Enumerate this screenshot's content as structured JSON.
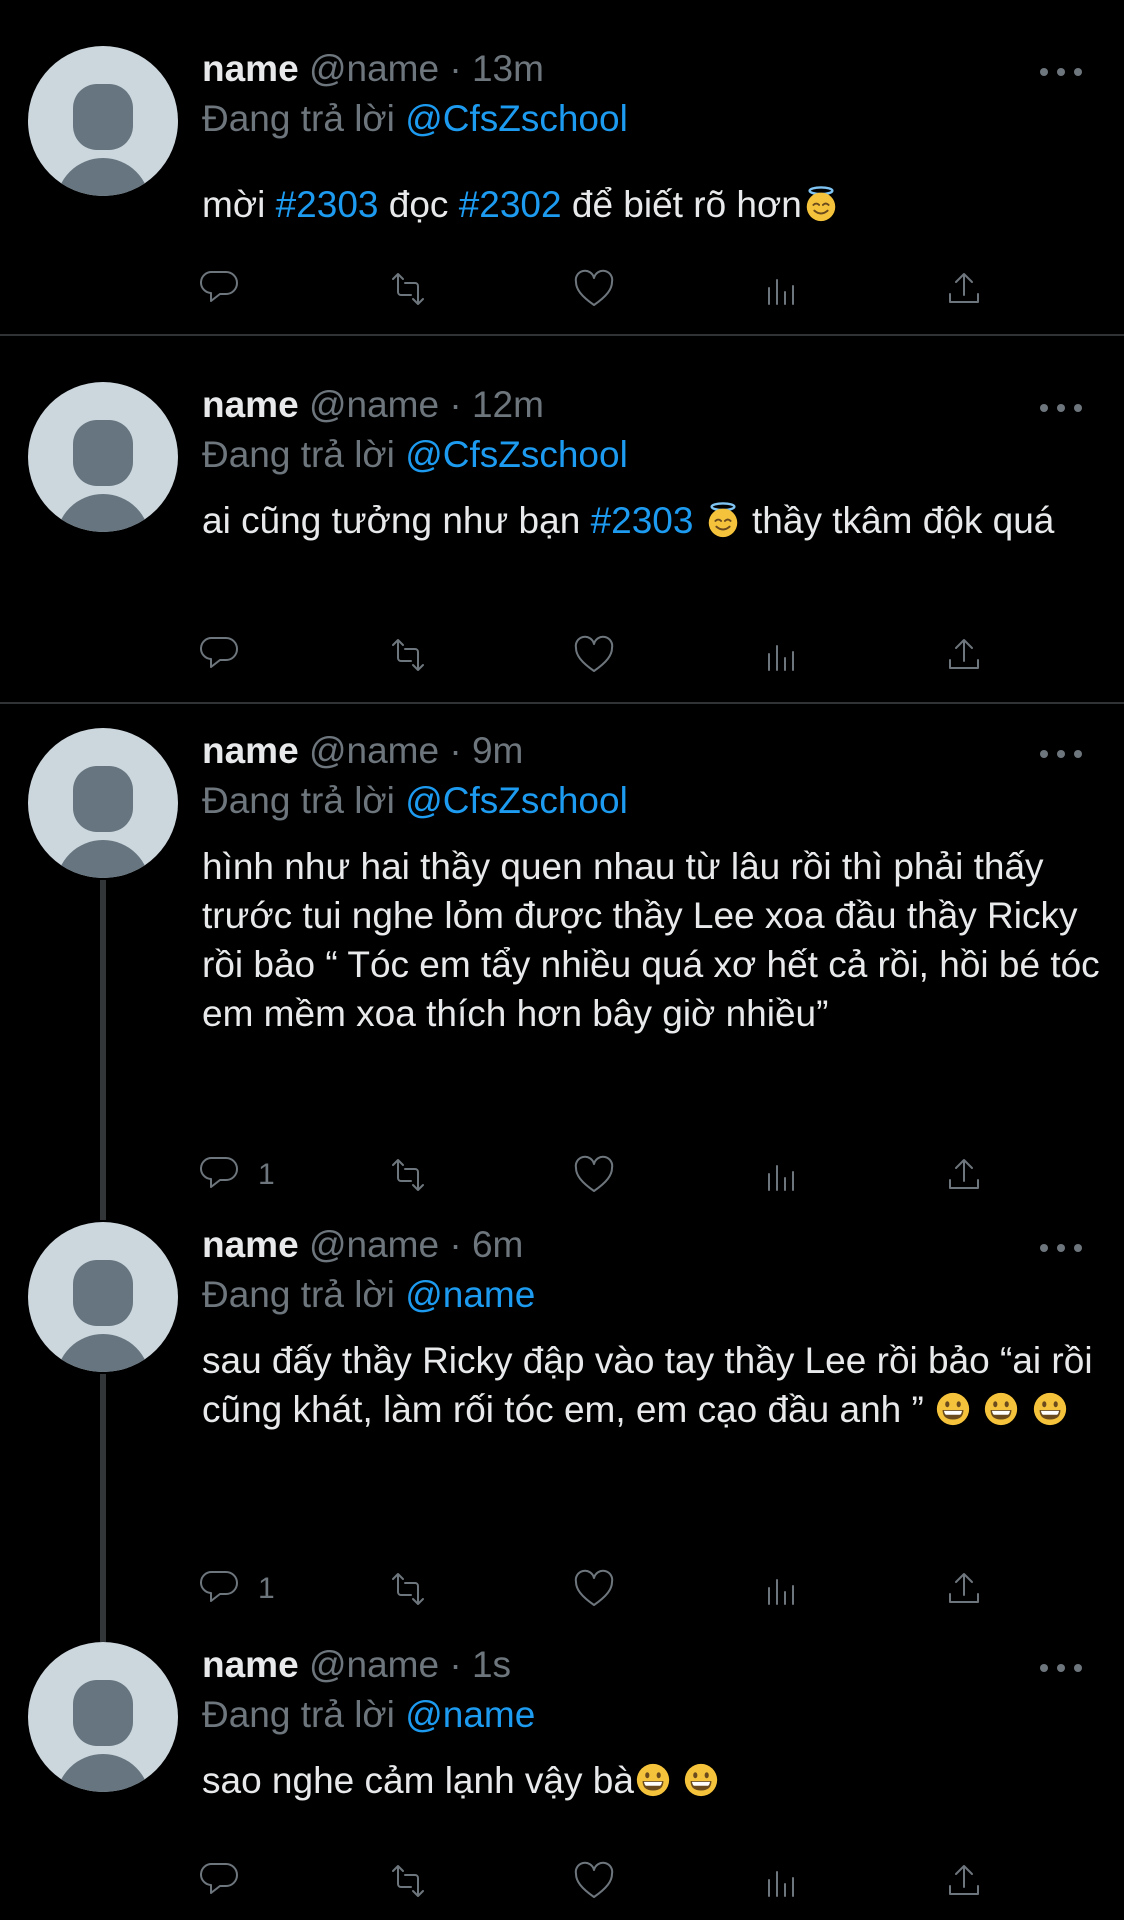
{
  "tweets": [
    {
      "name": "name",
      "handle": "@name",
      "dot": "·",
      "time": "13m",
      "reply_prefix": "Đang trả lời",
      "reply_to": "@CfsZschool",
      "reply_count": "",
      "segments": [
        {
          "t": "mời "
        },
        {
          "t": "#2303",
          "link": true
        },
        {
          "t": " đọc "
        },
        {
          "t": "#2302",
          "link": true
        },
        {
          "t": " để biết rõ hơn"
        },
        {
          "emoji": "halo"
        }
      ]
    },
    {
      "name": "name",
      "handle": "@name",
      "dot": "·",
      "time": "12m",
      "reply_prefix": "Đang trả lời",
      "reply_to": "@CfsZschool",
      "reply_count": "",
      "segments": [
        {
          "t": "ai cũng tưởng như bạn "
        },
        {
          "t": "#2303",
          "link": true
        },
        {
          "t": " "
        },
        {
          "emoji": "halo"
        },
        {
          "t": "  thầy tkâm độk quá"
        }
      ]
    },
    {
      "name": "name",
      "handle": "@name",
      "dot": "·",
      "time": "9m",
      "reply_prefix": "Đang trả lời",
      "reply_to": "@CfsZschool",
      "reply_count": "1",
      "segments": [
        {
          "t": "hình như hai thầy quen nhau từ lâu rồi thì phải thấy trước tui nghe lỏm được thầy Lee xoa đầu thầy Ricky rồi bảo “ Tóc em tẩy nhiều quá xơ hết cả rồi, hồi bé tóc em mềm xoa thích hơn bây giờ nhiều”"
        }
      ]
    },
    {
      "name": "name",
      "handle": "@name",
      "dot": "·",
      "time": "6m",
      "reply_prefix": "Đang trả lời",
      "reply_to": "@name",
      "reply_count": "1",
      "segments": [
        {
          "t": "sau đấy thầy Ricky đập vào tay thầy Lee rồi bảo “ai rồi cũng khát, làm rối tóc em, em cạo đầu anh ” "
        },
        {
          "emoji": "grin"
        },
        {
          "t": " "
        },
        {
          "emoji": "grin"
        },
        {
          "t": " "
        },
        {
          "emoji": "grin"
        }
      ]
    },
    {
      "name": "name",
      "handle": "@name",
      "dot": "·",
      "time": "1s",
      "reply_prefix": "Đang trả lời",
      "reply_to": "@name",
      "reply_count": "",
      "segments": [
        {
          "t": "sao nghe cảm lạnh vậy bà"
        },
        {
          "emoji": "grin"
        },
        {
          "t": " "
        },
        {
          "emoji": "grin"
        }
      ]
    }
  ],
  "icons": {
    "reply": "speech-bubble-icon",
    "retweet": "retweet-arrows-icon",
    "like": "heart-icon",
    "analytics": "bar-chart-icon",
    "share": "share-upload-icon",
    "more": "more-dots-icon"
  },
  "colors": {
    "background": "#000000",
    "text": "#e7e9ea",
    "secondary": "#6e767d",
    "link": "#1d9bf0",
    "divider": "#2f3336",
    "emoji": "#f5c33b"
  }
}
